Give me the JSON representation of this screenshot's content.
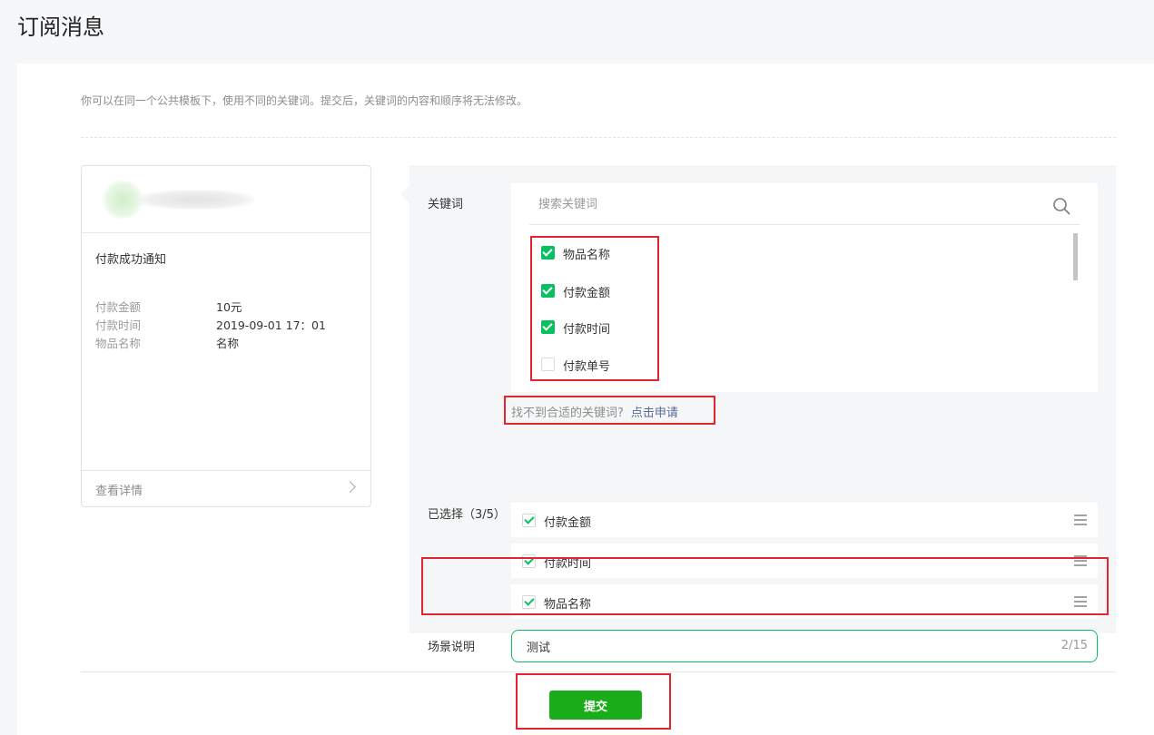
{
  "page_title": "订阅消息",
  "description": "你可以在同一个公共模板下，使用不同的关键词。提交后，关键词的内容和顺序将无法修改。",
  "preview": {
    "title": "付款成功通知",
    "fields": [
      {
        "key": "付款金额",
        "value": "10元"
      },
      {
        "key": "付款时间",
        "value": "2019-09-01 17：01"
      },
      {
        "key": "物品名称",
        "value": "名称"
      }
    ],
    "detail_link": "查看详情"
  },
  "keywords": {
    "label": "关键词",
    "search_placeholder": "搜索关键词",
    "options": [
      {
        "label": "物品名称",
        "checked": true
      },
      {
        "label": "付款金额",
        "checked": true
      },
      {
        "label": "付款时间",
        "checked": true
      },
      {
        "label": "付款单号",
        "checked": false
      }
    ],
    "not_found_text": "找不到合适的关键词?",
    "apply_link": "点击申请"
  },
  "selected": {
    "label": "已选择（3/5）",
    "items": [
      "付款金额",
      "付款时间",
      "物品名称"
    ]
  },
  "scene": {
    "label": "场景说明",
    "value": "测试",
    "counter": "2/15"
  },
  "submit_label": "提交",
  "colors": {
    "brand_green": "#07c160",
    "submit_green": "#1aad19",
    "link_blue": "#576b95",
    "highlight_red": "#e0262f"
  }
}
